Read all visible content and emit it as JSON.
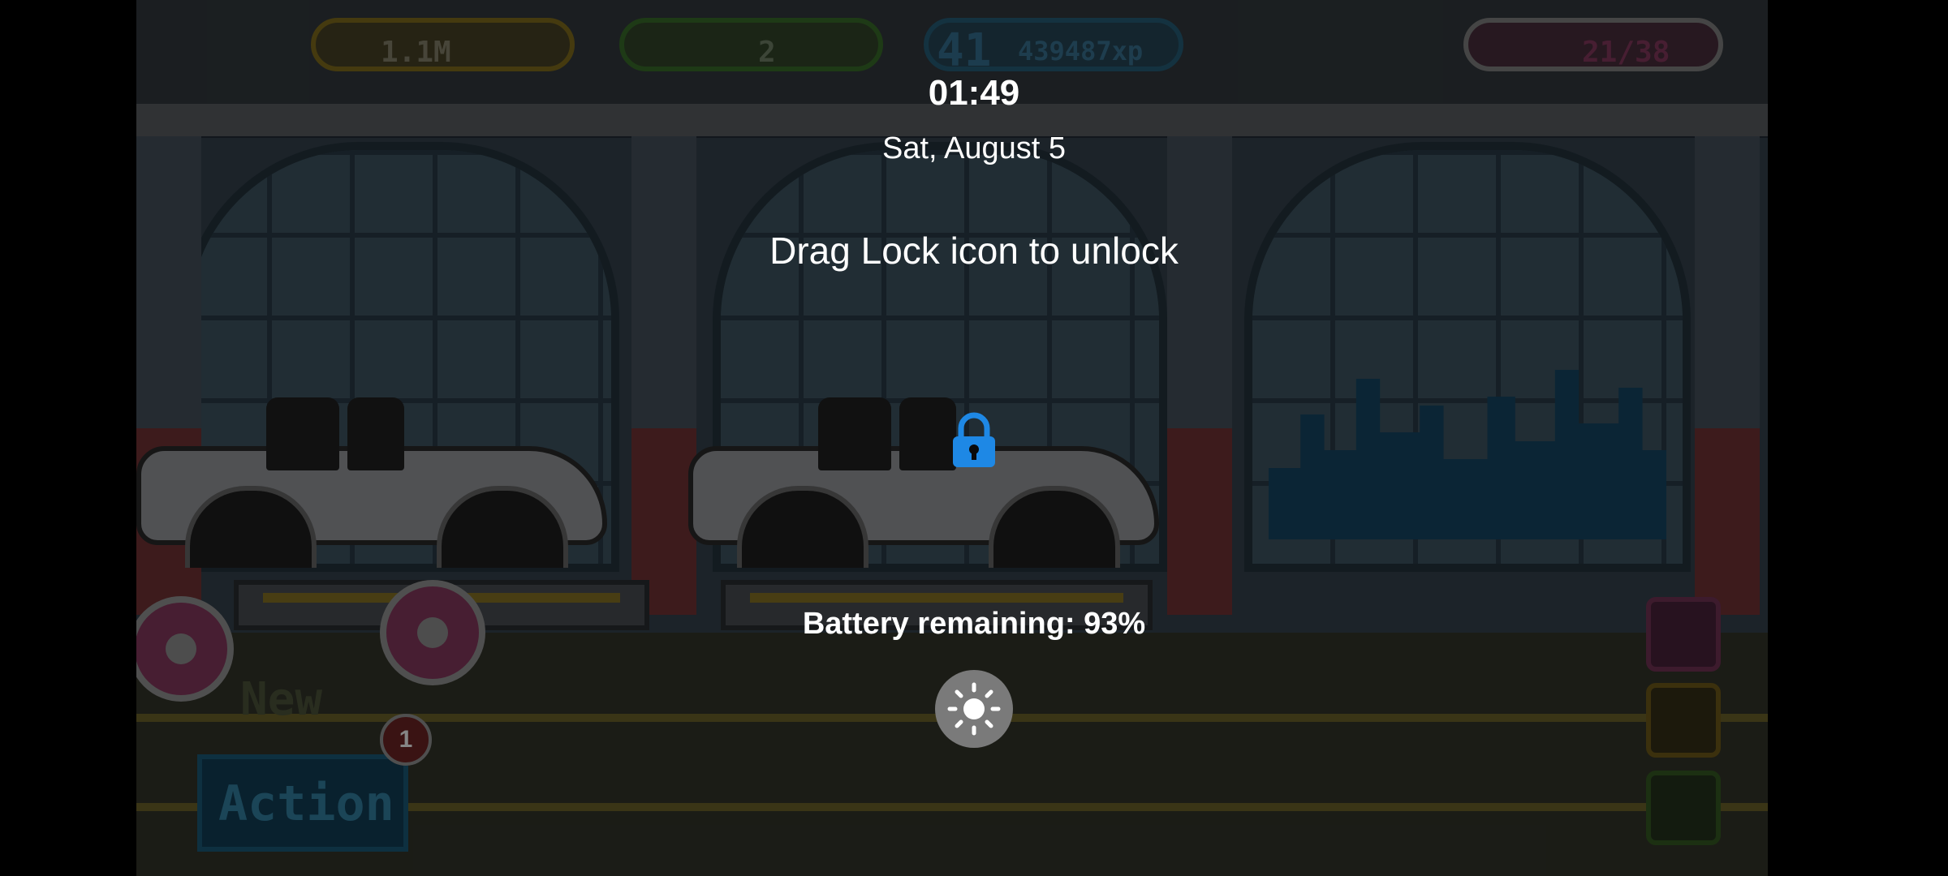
{
  "lockscreen": {
    "time": "01:49",
    "date": "Sat, August 5",
    "unlock_hint": "Drag Lock icon to unlock",
    "battery_text": "Battery remaining: 93%",
    "lock_icon": "lock-icon",
    "brightness_icon": "sun-icon",
    "accent_color": "#1e88e5"
  },
  "game": {
    "coins": "1.1M",
    "cash": "2",
    "level": "41",
    "xp": "439487xp",
    "donuts": "21/38",
    "new_label": "New",
    "action_label": "Action",
    "notification_count": "1"
  }
}
